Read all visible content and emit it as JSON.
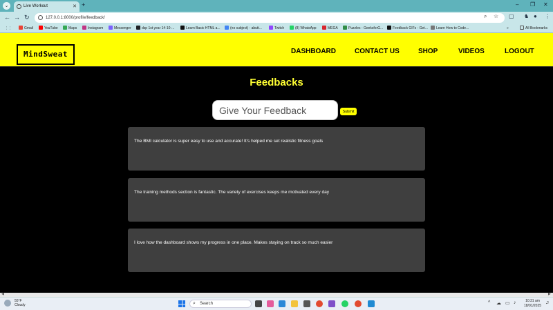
{
  "browser": {
    "tab_title": "Live Workout",
    "new_tab": "+",
    "url": "127.0.0.1:8000/profile/feedback/",
    "bookmarks": [
      {
        "label": "Gmail",
        "color": "#ea4335"
      },
      {
        "label": "YouTube",
        "color": "#ff0000"
      },
      {
        "label": "Maps",
        "color": "#34a853"
      },
      {
        "label": "Instagram",
        "color": "#c13584"
      },
      {
        "label": "Messenger",
        "color": "#7b61ff"
      },
      {
        "label": "dsp 1st year 14-10-...",
        "color": "#202124"
      },
      {
        "label": "Learn Basic HTML a...",
        "color": "#111111"
      },
      {
        "label": "(no subject) - abutt...",
        "color": "#4285f4"
      },
      {
        "label": "Twitch",
        "color": "#9146ff"
      },
      {
        "label": "(8) WhatsApp",
        "color": "#25d366"
      },
      {
        "label": "MEGA",
        "color": "#d9272e"
      },
      {
        "label": "Puzzles - GeeksforG...",
        "color": "#2f8d46"
      },
      {
        "label": "Feedback GIFs - Get...",
        "color": "#111111"
      },
      {
        "label": "Learn How to Code...",
        "color": "#777777"
      }
    ],
    "all_bookmarks": "All Bookmarks"
  },
  "site": {
    "logo": "MindSweat",
    "nav": [
      "DASHBOARD",
      "CONTACT US",
      "SHOP",
      "VIDEOS",
      "LOGOUT"
    ],
    "accent_color": "#ffff00"
  },
  "main": {
    "title": "Feedbacks",
    "input_placeholder": "Give Your Feedback",
    "submit_label": "Submit",
    "feedbacks": [
      "The BMI calculator is super easy to use and accurate! It's helped me set realistic fitness goals",
      "The training methods section is fantastic. The variety of exercises keeps me motivated every day",
      "I love how the dashboard shows my progress in one place. Makes staying on track so much easier"
    ]
  },
  "taskbar": {
    "weather_temp": "55°F",
    "weather_desc": "Cloudy",
    "search_placeholder": "Search",
    "time": "10:31 am",
    "date": "18/01/2025"
  }
}
